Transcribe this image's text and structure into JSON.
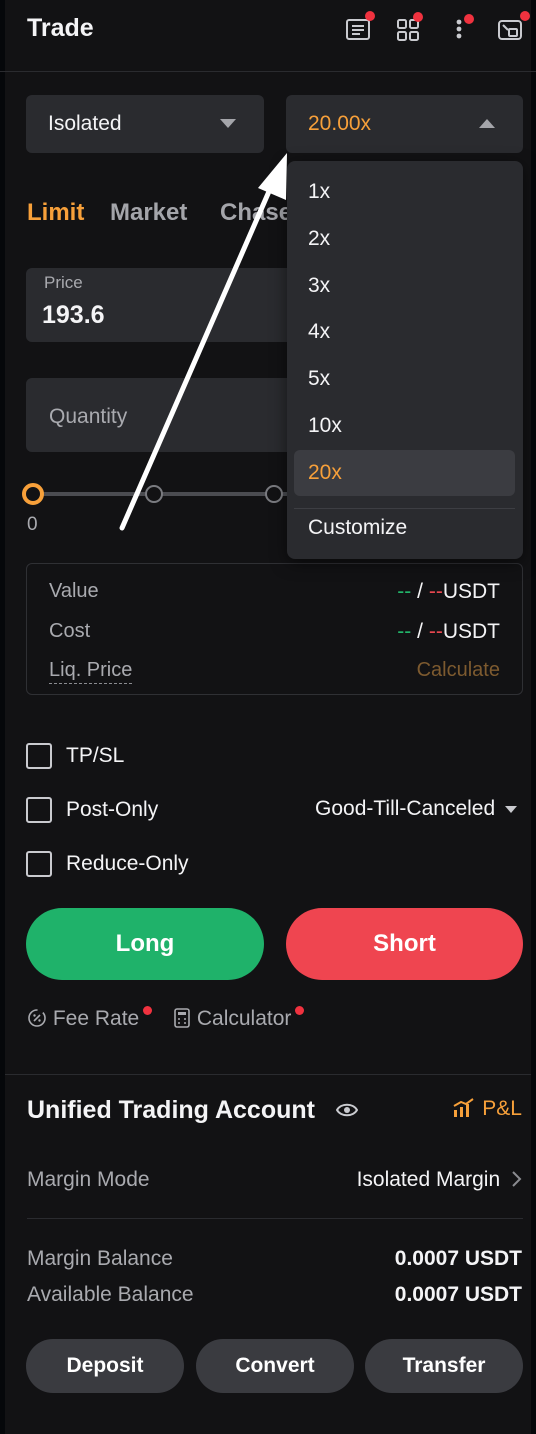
{
  "header": {
    "title": "Trade",
    "icons": [
      "orders-icon",
      "apps-icon",
      "more-icon",
      "window-icon"
    ],
    "badge_color": "#f0323f"
  },
  "margin_selector": {
    "value": "Isolated"
  },
  "leverage_selector": {
    "value": "20.00x"
  },
  "order_tabs": [
    "Limit",
    "Market",
    "Chase"
  ],
  "price_field": {
    "label": "Price",
    "value": "193.6"
  },
  "quantity_field": {
    "placeholder": "Quantity"
  },
  "slider": {
    "start_label": "0",
    "value_fraction": 0
  },
  "info": {
    "value_label": "Value",
    "cost_label": "Cost",
    "liq_label": "Liq. Price",
    "dash_buy": "--",
    "slash": "/",
    "dash_sell": "--",
    "unit": "USDT",
    "calculate": "Calculate"
  },
  "options": {
    "tpsl": "TP/SL",
    "post_only": "Post-Only",
    "reduce_only": "Reduce-Only",
    "time_in_force": "Good-Till-Canceled"
  },
  "actions": {
    "long": "Long",
    "short": "Short"
  },
  "tools": {
    "fee_rate": "Fee Rate",
    "calculator": "Calculator"
  },
  "account": {
    "title": "Unified Trading Account",
    "pnl": "P&L",
    "margin_mode_label": "Margin Mode",
    "margin_mode_value": "Isolated Margin",
    "margin_balance_label": "Margin Balance",
    "margin_balance_value": "0.0007 USDT",
    "available_balance_label": "Available Balance",
    "available_balance_value": "0.0007 USDT"
  },
  "buttons": {
    "deposit": "Deposit",
    "convert": "Convert",
    "transfer": "Transfer"
  },
  "leverage_dropdown": {
    "options": [
      "1x",
      "2x",
      "3x",
      "4x",
      "5x",
      "10x",
      "20x"
    ],
    "selected": "20x",
    "customize": "Customize"
  },
  "colors": {
    "accent": "#f7a03a",
    "long": "#1fb26a",
    "short": "#ef4550",
    "background": "#121214",
    "panel": "#2a2b2f"
  }
}
